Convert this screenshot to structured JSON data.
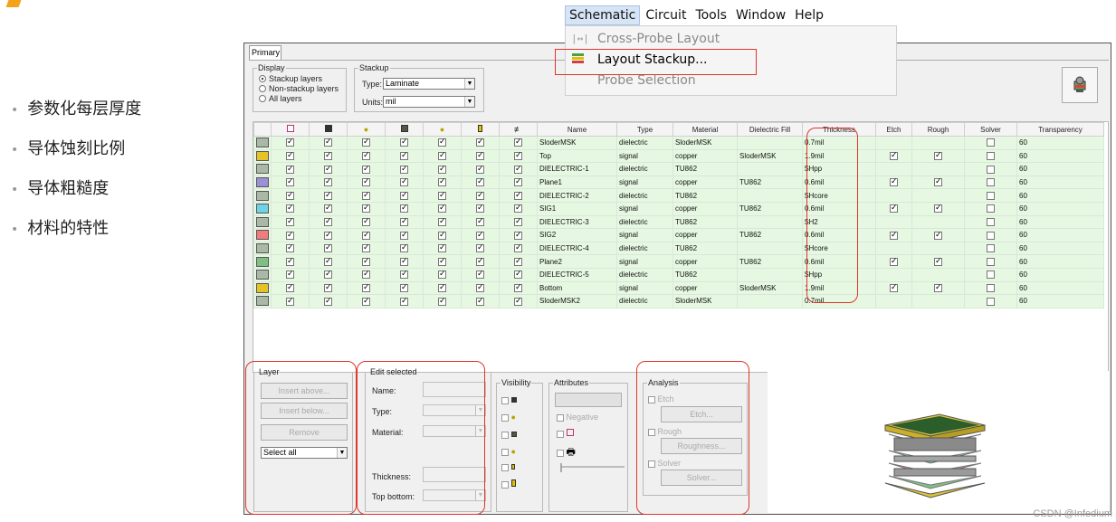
{
  "bullets": [
    "参数化每层厚度",
    "导体蚀刻比例",
    "导体粗糙度",
    "材料的特性"
  ],
  "menu": {
    "bar": [
      "Schematic",
      "Circuit",
      "Tools",
      "Window",
      "Help"
    ],
    "items": [
      {
        "label": "Cross-Probe Layout",
        "enabled": false
      },
      {
        "label": "Layout Stackup...",
        "enabled": true
      },
      {
        "label": "Probe Selection",
        "enabled": false
      }
    ]
  },
  "tab": "Primary",
  "display": {
    "legend": "Display",
    "options": [
      "Stackup layers",
      "Non-stackup layers",
      "All layers"
    ],
    "selected": 0
  },
  "stackup": {
    "legend": "Stackup",
    "type_label": "Type:",
    "type_value": "Laminate",
    "units_label": "Units:",
    "units_value": "mil"
  },
  "table": {
    "headers": [
      "Name",
      "Type",
      "Material",
      "Dielectric Fill",
      "Thickness",
      "Etch",
      "Rough",
      "Solver",
      "Transparency"
    ],
    "rows": [
      {
        "color": "#aab8a8",
        "name": "SloderMSK",
        "type": "dielectric",
        "material": "SloderMSK",
        "fill": "",
        "thickness": "0.7mil",
        "etch": false,
        "rough": false,
        "transparency": "60"
      },
      {
        "color": "#e6c229",
        "name": "Top",
        "type": "signal",
        "material": "copper",
        "fill": "SloderMSK",
        "thickness": "1.9mil",
        "etch": true,
        "rough": true,
        "transparency": "60"
      },
      {
        "color": "#aab8a8",
        "name": "DIELECTRIC-1",
        "type": "dielectric",
        "material": "TU862",
        "fill": "",
        "thickness": "$Hpp",
        "etch": false,
        "rough": false,
        "transparency": "60"
      },
      {
        "color": "#9b8fd6",
        "name": "Plane1",
        "type": "signal",
        "material": "copper",
        "fill": "TU862",
        "thickness": "0.6mil",
        "etch": true,
        "rough": true,
        "transparency": "60"
      },
      {
        "color": "#aab8a8",
        "name": "DIELECTRIC-2",
        "type": "dielectric",
        "material": "TU862",
        "fill": "",
        "thickness": "$Hcore",
        "etch": false,
        "rough": false,
        "transparency": "60"
      },
      {
        "color": "#6ed3e8",
        "name": "SIG1",
        "type": "signal",
        "material": "copper",
        "fill": "TU862",
        "thickness": "0.6mil",
        "etch": true,
        "rough": true,
        "transparency": "60"
      },
      {
        "color": "#aab8a8",
        "name": "DIELECTRIC-3",
        "type": "dielectric",
        "material": "TU862",
        "fill": "",
        "thickness": "$H2",
        "etch": false,
        "rough": false,
        "transparency": "60"
      },
      {
        "color": "#f07c7c",
        "name": "SIG2",
        "type": "signal",
        "material": "copper",
        "fill": "TU862",
        "thickness": "0.6mil",
        "etch": true,
        "rough": true,
        "transparency": "60"
      },
      {
        "color": "#aab8a8",
        "name": "DIELECTRIC-4",
        "type": "dielectric",
        "material": "TU862",
        "fill": "",
        "thickness": "$Hcore",
        "etch": false,
        "rough": false,
        "transparency": "60"
      },
      {
        "color": "#7fbf86",
        "name": "Plane2",
        "type": "signal",
        "material": "copper",
        "fill": "TU862",
        "thickness": "0.6mil",
        "etch": true,
        "rough": true,
        "transparency": "60"
      },
      {
        "color": "#aab8a8",
        "name": "DIELECTRIC-5",
        "type": "dielectric",
        "material": "TU862",
        "fill": "",
        "thickness": "$Hpp",
        "etch": false,
        "rough": false,
        "transparency": "60"
      },
      {
        "color": "#e6c229",
        "name": "Bottom",
        "type": "signal",
        "material": "copper",
        "fill": "SloderMSK",
        "thickness": "1.9mil",
        "etch": true,
        "rough": true,
        "transparency": "60"
      },
      {
        "color": "#aab8a8",
        "name": "SloderMSK2",
        "type": "dielectric",
        "material": "SloderMSK",
        "fill": "",
        "thickness": "0.7mil",
        "etch": false,
        "rough": false,
        "transparency": "60"
      }
    ]
  },
  "layer": {
    "legend": "Layer",
    "insert_above": "Insert above...",
    "insert_below": "Insert below...",
    "remove": "Remove",
    "select": "Select all"
  },
  "edit": {
    "legend": "Edit selected",
    "name": "Name:",
    "type": "Type:",
    "material": "Material:",
    "thickness": "Thickness:",
    "top_bottom": "Top bottom:"
  },
  "visibility": {
    "legend": "Visibility"
  },
  "attributes": {
    "legend": "Attributes",
    "negative": "Negative"
  },
  "analysis": {
    "legend": "Analysis",
    "etch": "Etch",
    "etch_btn": "Etch...",
    "rough": "Rough",
    "rough_btn": "Roughness...",
    "solver": "Solver",
    "solver_btn": "Solver..."
  },
  "watermark": "CSDN @Infedium"
}
